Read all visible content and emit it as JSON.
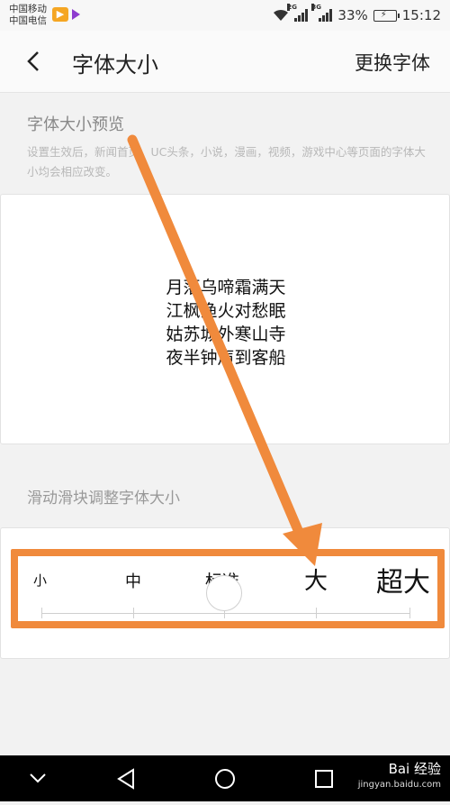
{
  "status_bar": {
    "carrier1": "中国移动",
    "carrier2": "中国电信",
    "sig1_tag": "2G",
    "sig2_tag": "3G",
    "battery": "33%",
    "time": "15:12"
  },
  "header": {
    "title": "字体大小",
    "action": "更换字体",
    "back_icon": "chevron-left-icon"
  },
  "preview": {
    "section_title": "字体大小预览",
    "description": "设置生效后，新闻首页，UC头条，小说，漫画，视频，游戏中心等页面的字体大小均会相应改变。",
    "poem": [
      "月落乌啼霜满天",
      "江枫渔火对愁眠",
      "姑苏城外寒山寺",
      "夜半钟声到客船"
    ]
  },
  "slider": {
    "section_title": "滑动滑块调整字体大小",
    "sizes": [
      "小",
      "中",
      "标准",
      "大",
      "超大"
    ],
    "selected": "标准"
  },
  "annotation": {
    "color": "#f08a3c"
  },
  "nav": {
    "icons": [
      "chevron-down-icon",
      "back-triangle-icon",
      "home-circle-icon",
      "recent-square-icon"
    ]
  },
  "watermark": {
    "brand": "Bai 经验",
    "url": "jingyan.baidu.com"
  }
}
